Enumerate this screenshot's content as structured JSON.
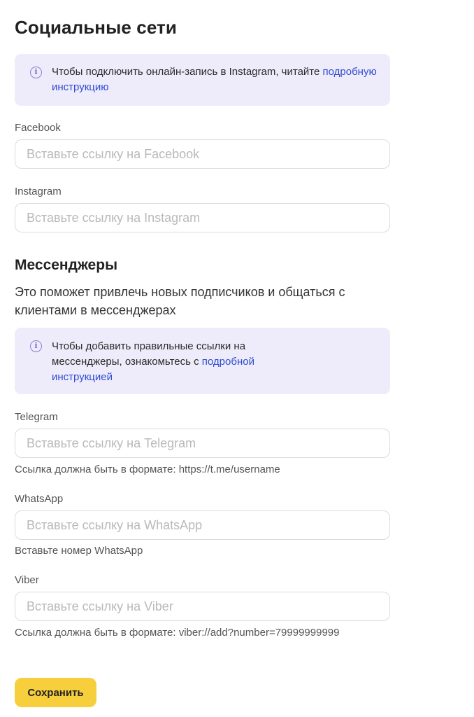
{
  "social": {
    "title": "Социальные сети",
    "note": {
      "icon": "info-icon",
      "text": "Чтобы подключить онлайн-запись в Instagram, читайте ",
      "link": "подробную инструкцию"
    },
    "facebook": {
      "label": "Facebook",
      "value": "",
      "placeholder": "Вставьте ссылку на Facebook"
    },
    "instagram": {
      "label": "Instagram",
      "value": "",
      "placeholder": "Вставьте ссылку на Instagram"
    }
  },
  "messengers": {
    "title": "Мессенджеры",
    "description": "Это поможет привлечь новых подписчиков и общаться с клиентами в мессенджерах",
    "note": {
      "icon": "info-icon",
      "text": "Чтобы добавить правильные ссылки на мессенджеры, ознакомьтесь с ",
      "link": "подробной инструкцией"
    },
    "telegram": {
      "label": "Telegram",
      "value": "",
      "placeholder": "Вставьте ссылку на Telegram",
      "hint": "Ссылка должна быть в формате: https://t.me/username"
    },
    "whatsapp": {
      "label": "WhatsApp",
      "value": "",
      "placeholder": "Вставьте ссылку на WhatsApp",
      "hint": "Вставьте номер WhatsApp"
    },
    "viber": {
      "label": "Viber",
      "value": "",
      "placeholder": "Вставьте ссылку на Viber",
      "hint": "Ссылка должна быть в формате: viber://add?number=79999999999"
    }
  },
  "actions": {
    "save_label": "Сохранить"
  },
  "colors": {
    "accent_button": "#f7cf3c",
    "note_background": "#eeecfa",
    "link": "#2f4bd2"
  }
}
